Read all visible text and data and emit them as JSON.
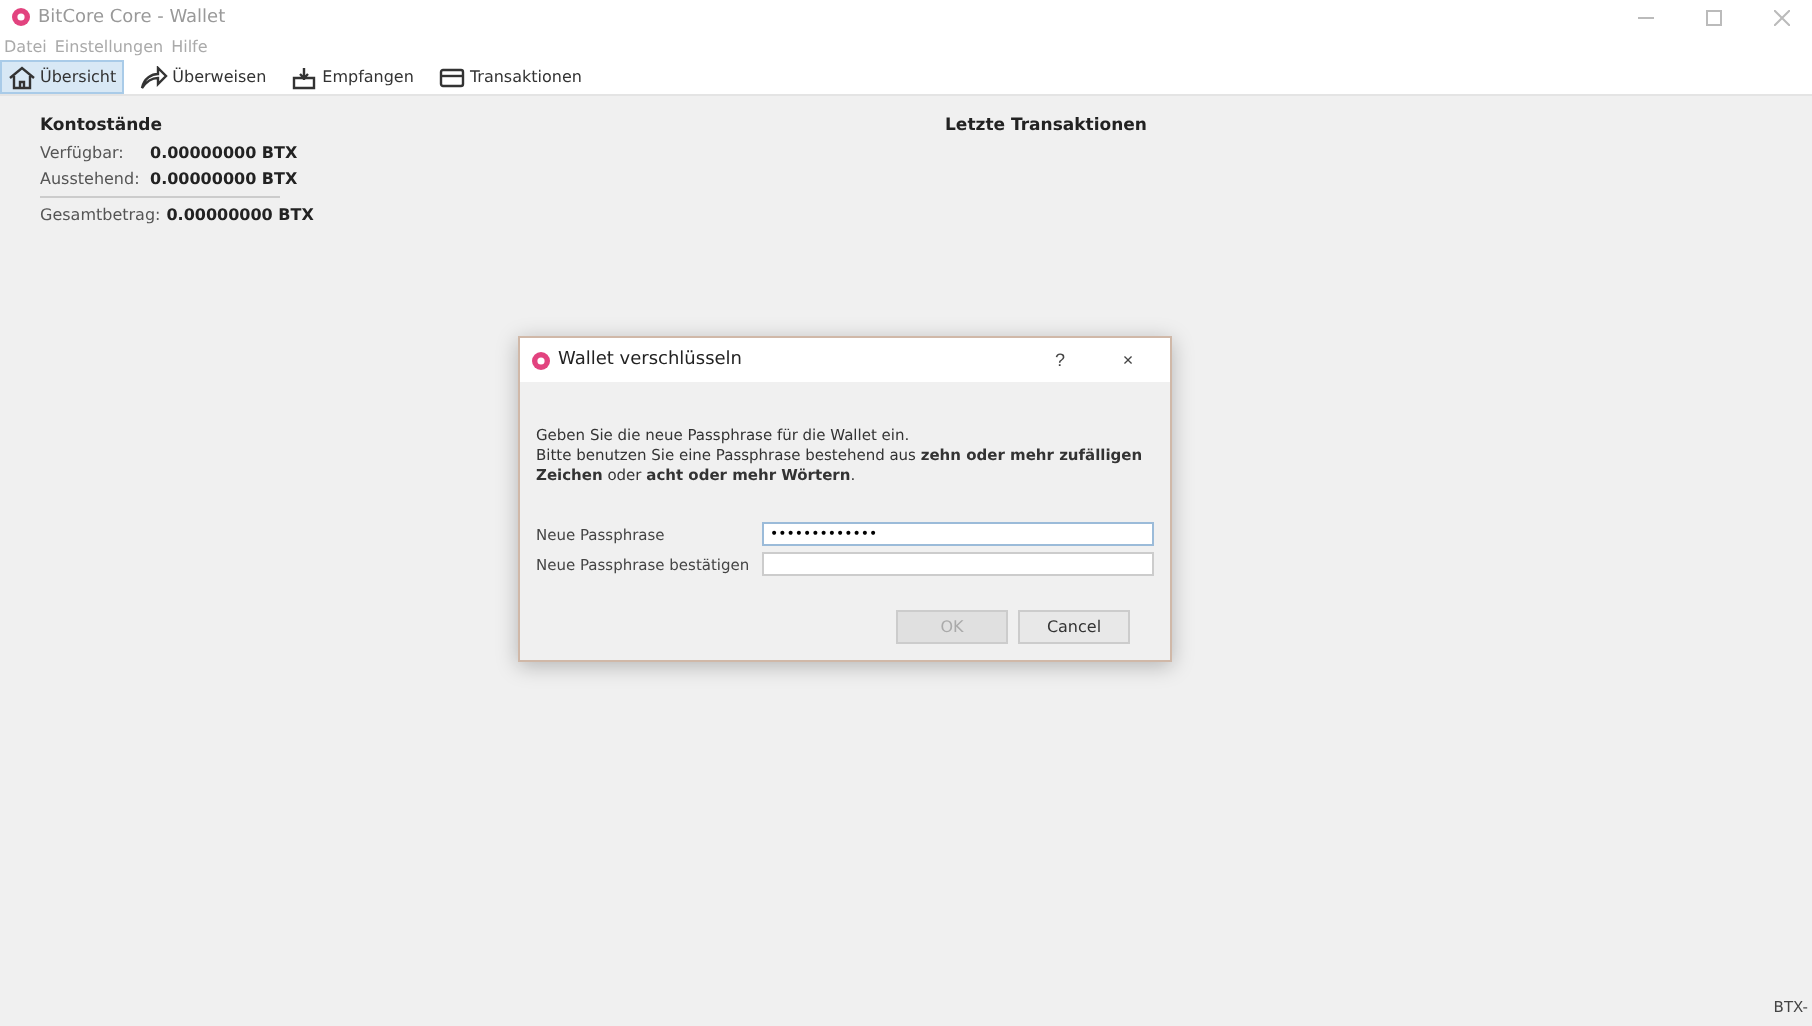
{
  "window": {
    "title": "BitCore Core - Wallet"
  },
  "menu": [
    "Datei",
    "Einstellungen",
    "Hilfe"
  ],
  "tabs": [
    {
      "label": "Übersicht",
      "kind": "home",
      "selected": true
    },
    {
      "label": "Überweisen",
      "kind": "send",
      "selected": false
    },
    {
      "label": "Empfangen",
      "kind": "receive",
      "selected": false
    },
    {
      "label": "Transaktionen",
      "kind": "card",
      "selected": false
    }
  ],
  "balances": {
    "title": "Kontostände",
    "rows": [
      {
        "label": "Verfügbar:",
        "value": "0.00000000 BTX"
      },
      {
        "label": "Ausstehend:",
        "value": "0.00000000 BTX"
      }
    ],
    "total": {
      "label": "Gesamtbetrag:",
      "value": "0.00000000 BTX"
    }
  },
  "recent": {
    "title": "Letzte Transaktionen"
  },
  "dialog": {
    "title": "Wallet verschlüsseln",
    "help": "?",
    "close": "×",
    "text": [
      "Geben Sie die neue Passphrase für die Wallet ein.",
      "Bitte benutzen Sie eine Passphrase bestehend aus **zehn oder mehr zufälligen Zeichen** oder **acht oder mehr Wörtern**."
    ],
    "fields": [
      {
        "label": "Neue Passphrase",
        "value": "•••••••••••••",
        "focused": true
      },
      {
        "label": "Neue Passphrase bestätigen",
        "focused": false
      }
    ],
    "buttons": [
      {
        "label": "OK",
        "disabled": true
      },
      {
        "label": "Cancel",
        "disabled": false
      }
    ]
  },
  "status_bar": {
    "unit": "BTX-"
  }
}
